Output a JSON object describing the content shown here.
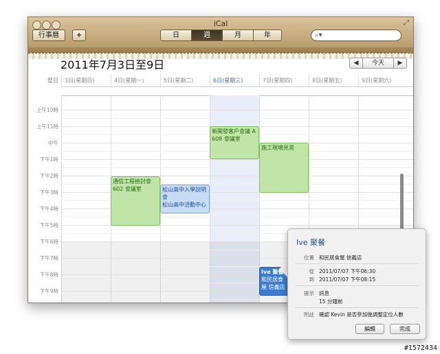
{
  "window": {
    "title": "iCal"
  },
  "toolbar": {
    "calendars_label": "行事曆",
    "add_label": "+",
    "views": [
      {
        "label": "日",
        "active": false
      },
      {
        "label": "週",
        "active": true
      },
      {
        "label": "月",
        "active": false
      },
      {
        "label": "年",
        "active": false
      }
    ],
    "search_icon": "search-icon"
  },
  "header": {
    "range_title": "2011年7月3日至9日",
    "prev_label": "◀",
    "today_label": "今天",
    "next_label": "▶"
  },
  "week": {
    "allday_label": "整日",
    "days": [
      "3日(星期日)",
      "4日(星期一)",
      "5日(星期二)",
      "6日(星期三)",
      "7日(星期四)",
      "8日(星期五)",
      "9日(星期六)"
    ],
    "today_index": 3,
    "hours": [
      "上午10時",
      "上午11時",
      "中午",
      "下午1時",
      "下午2時",
      "下午3時",
      "下午4時",
      "下午5時",
      "下午6時",
      "下午7時",
      "下午8時",
      "下午9時"
    ]
  },
  "events": [
    {
      "title": "新開發客戶會議 A",
      "location": "608 會議室",
      "color": "green"
    },
    {
      "title": "施工現場見習",
      "location": "",
      "color": "green"
    },
    {
      "title": "通信工程檢討會",
      "location": "602 會議室",
      "color": "green"
    },
    {
      "title": "松山高中入學說明會",
      "location": "松山高中活動中心",
      "color": "blue"
    },
    {
      "title": "Ive 聚餐",
      "location": "和民居食屋 信義店",
      "color": "selected"
    }
  ],
  "popover": {
    "title": "Ive 聚餐",
    "location_label": "位置",
    "location_value": "和民居食屋 信義店",
    "from_label": "從",
    "from_value": "2011/07/07 下午06:30",
    "to_label": "到",
    "to_value": "2011/07/07 下午08:15",
    "alert_label": "提示",
    "alert_value": "訊息",
    "alert_value_2": "15 分鐘前",
    "note_label": "附註",
    "note_value": "確認 Kevin 是否參加後調整定位人數",
    "edit_label": "編輯",
    "done_label": "完成"
  },
  "watermark": "#1572434",
  "colors": {
    "today_column": "#e7eef9",
    "event_green": "#bfe5a9",
    "event_blue": "#c6dbf5",
    "event_selected": "#3b7bd4"
  }
}
